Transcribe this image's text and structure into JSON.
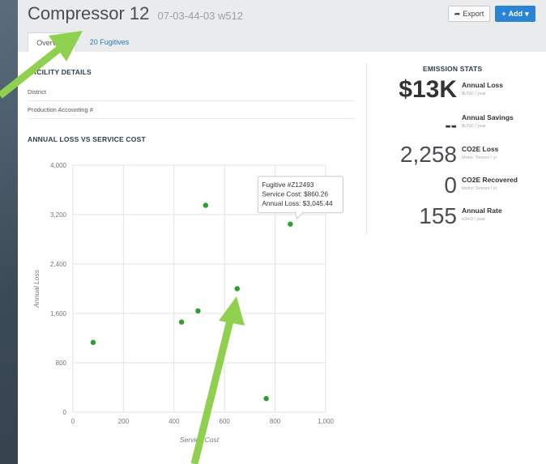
{
  "page": {
    "title": "Compressor 12",
    "subtitle": "07-03-44-03 w512",
    "export_label": "Export",
    "add_label": "Add",
    "tabs": [
      {
        "label": "Overview",
        "active": true
      },
      {
        "label": "20 Fugitives",
        "active": false
      }
    ]
  },
  "facility_details": {
    "title": "FACILITY DETAILS",
    "rows": [
      {
        "label": "District"
      },
      {
        "label": "Production Accounting #"
      }
    ]
  },
  "emission_stats": {
    "title": "EMISSION STATS",
    "items": [
      {
        "value": "$13K",
        "label": "Annual Loss",
        "unit": "$USD / year",
        "bold": true
      },
      {
        "value": "--",
        "label": "Annual Savings",
        "unit": "$USD / year",
        "bold": true
      },
      {
        "value": "2,258",
        "label": "CO2E Loss",
        "unit": "Metric Tonnes / yr",
        "bold": false
      },
      {
        "value": "0",
        "label": "CO2E Recovered",
        "unit": "Metric Tonnes / yr",
        "bold": false
      },
      {
        "value": "155",
        "label": "Annual Rate",
        "unit": "e3m3 / year",
        "bold": false
      }
    ]
  },
  "chart_data": {
    "type": "scatter",
    "title": "ANNUAL LOSS VS SERVICE COST",
    "xlabel": "Service Cost",
    "ylabel": "Annual Loss",
    "xlim": [
      0,
      1000
    ],
    "ylim": [
      0,
      4000
    ],
    "xticks": [
      "0",
      "200",
      "400",
      "600",
      "800",
      "1,000"
    ],
    "yticks": [
      "0",
      "800",
      "1,600",
      "2,400",
      "3,200",
      "4,000"
    ],
    "grid": true,
    "color": "#2ca02c",
    "points": [
      {
        "x": 80,
        "y": 1130
      },
      {
        "x": 430,
        "y": 1460
      },
      {
        "x": 495,
        "y": 1640
      },
      {
        "x": 525,
        "y": 3350
      },
      {
        "x": 650,
        "y": 2000
      },
      {
        "x": 765,
        "y": 220
      },
      {
        "x": 860.26,
        "y": 3045.44
      }
    ],
    "tooltip": {
      "point_index": 6,
      "lines": [
        "Fugitive #Z12493",
        "Service Cost: $860.26",
        "Annual Loss: $3,045.44"
      ]
    }
  }
}
